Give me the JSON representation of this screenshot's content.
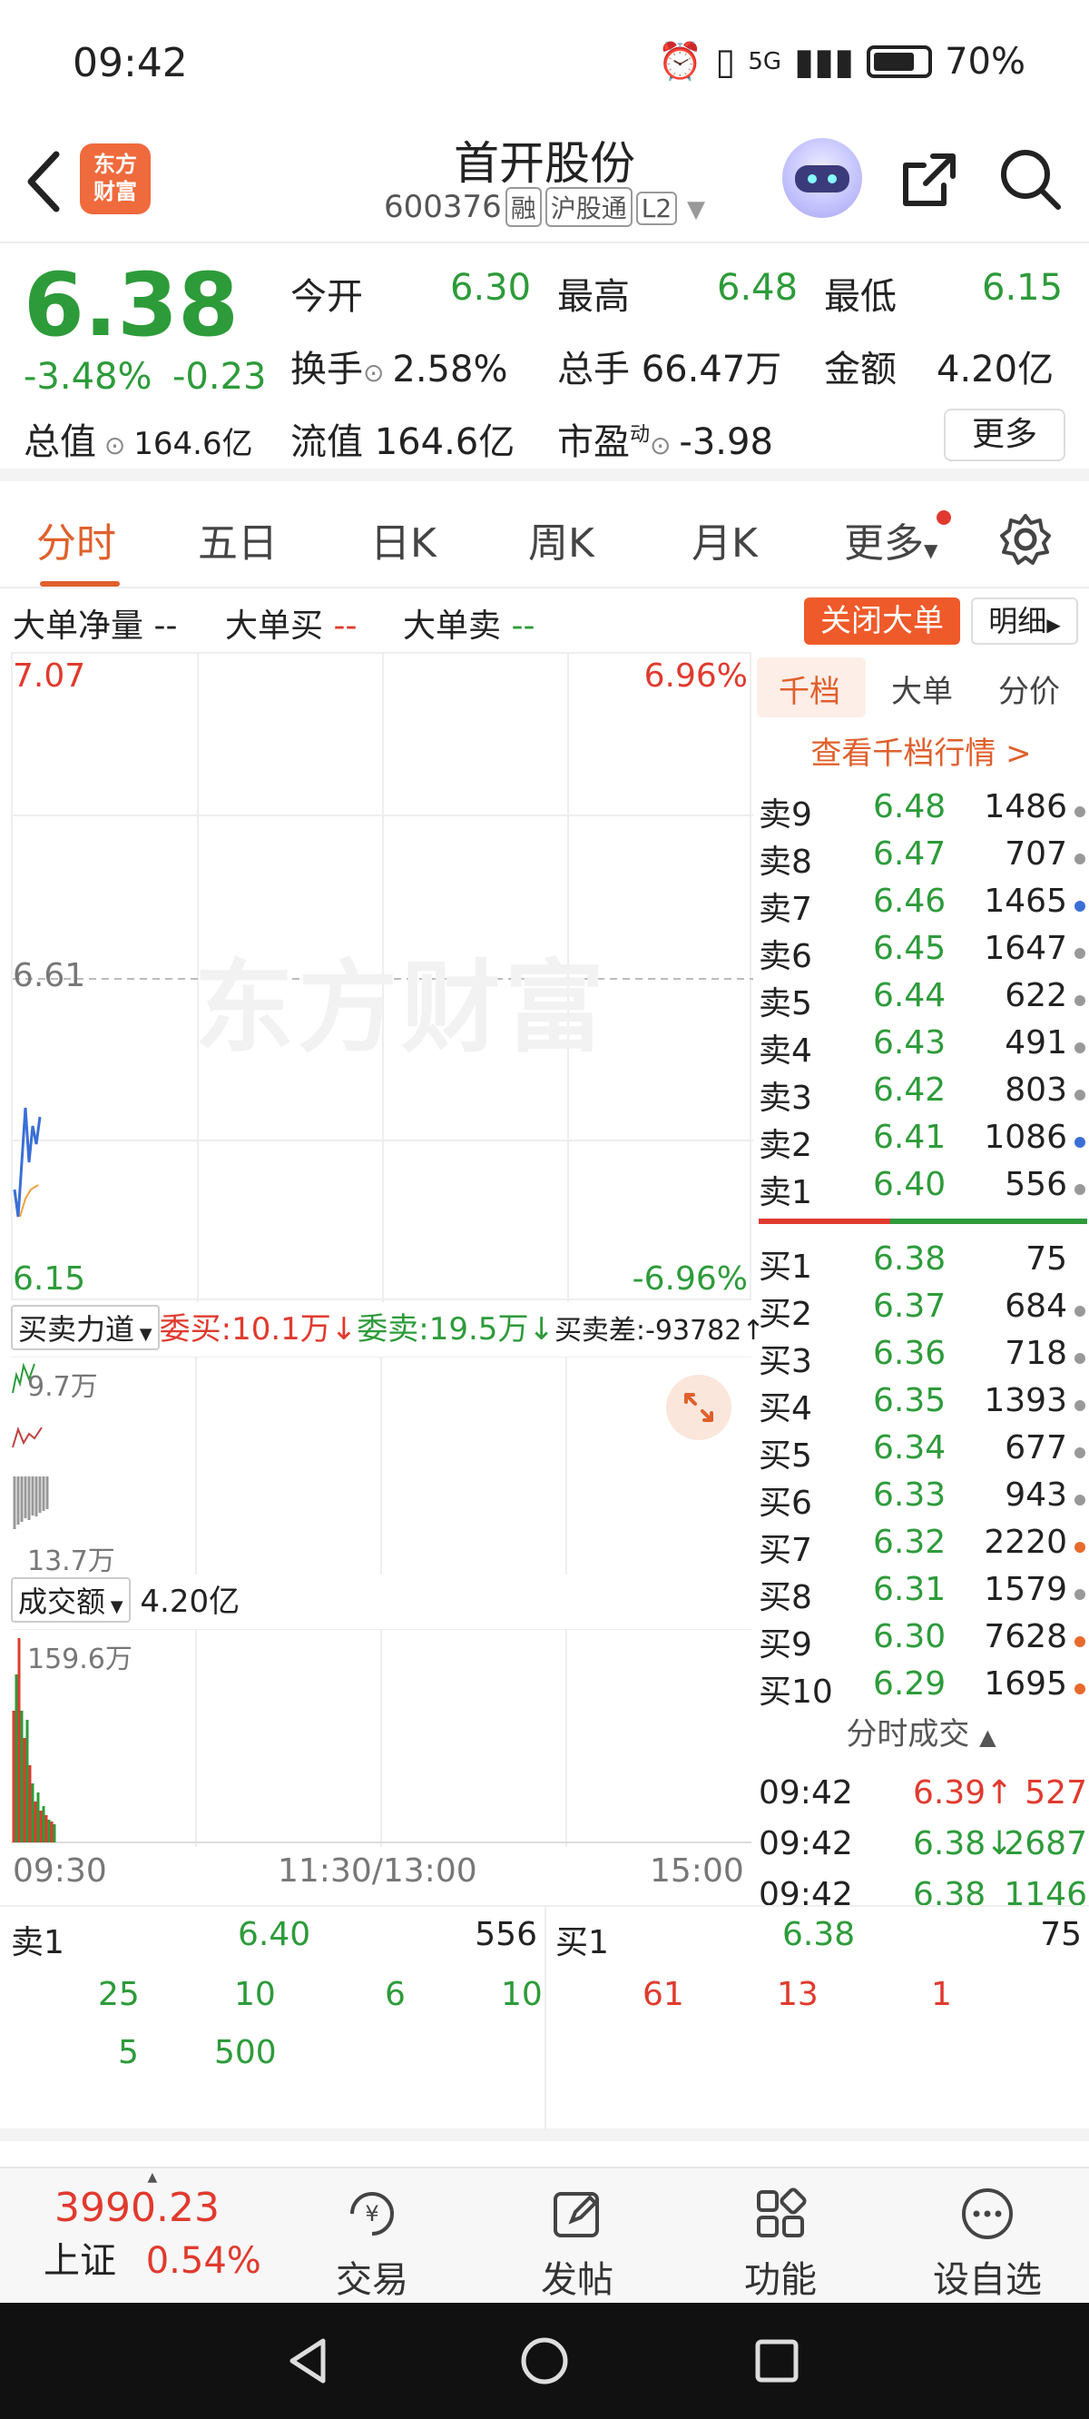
{
  "status_bar": {
    "time": "09:42",
    "network": "5G",
    "battery": "70%"
  },
  "header": {
    "logo_text": "东方\n财富",
    "stock_name": "首开股份",
    "stock_code": "600376",
    "tags": [
      "融",
      "沪股通",
      "L2"
    ]
  },
  "quote": {
    "price": "6.38",
    "change_pct": "-3.48%",
    "change": "-0.23",
    "open_label": "今开",
    "open": "6.30",
    "high_label": "最高",
    "high": "6.48",
    "low_label": "最低",
    "low": "6.15",
    "turnover_label": "换手",
    "turnover": "2.58%",
    "volume_label": "总手",
    "volume": "66.47万",
    "amount_label": "金额",
    "amount": "4.20亿",
    "mktcap_label": "总值",
    "mktcap": "164.6亿",
    "float_label": "流值",
    "float_cap": "164.6亿",
    "pe_label": "市盈",
    "pe_sup": "动",
    "pe": "-3.98",
    "more_label": "更多"
  },
  "tabs": [
    "分时",
    "五日",
    "日K",
    "周K",
    "月K",
    "更多"
  ],
  "big_order": {
    "net_label": "大单净量",
    "net_value": "--",
    "buy_label": "大单买",
    "buy_value": "--",
    "sell_label": "大单卖",
    "sell_value": "--",
    "close_button": "关闭大单",
    "detail_button": "明细"
  },
  "chart": {
    "top_price": "7.07",
    "top_pct": "6.96%",
    "mid_price": "6.61",
    "bottom_price": "6.15",
    "bottom_pct": "-6.96%",
    "watermark": "东方财富",
    "time_start": "09:30",
    "time_mid": "11:30/13:00",
    "time_end": "15:00"
  },
  "force": {
    "dropdown": "买卖力道",
    "bid_label": "委买:",
    "bid_value": "10.1万",
    "ask_label": "委卖:",
    "ask_value": "19.5万",
    "diff_label": "买卖差:",
    "diff_value": "-93782",
    "top_scale": "9.7万",
    "bottom_scale": "13.7万"
  },
  "volume": {
    "dropdown": "成交额",
    "total": "4.20亿",
    "scale": "159.6万"
  },
  "order_book": {
    "tabs": [
      "千档",
      "大单",
      "分价"
    ],
    "link": "查看千档行情 >",
    "asks": [
      {
        "label": "卖9",
        "price": "6.48",
        "vol": "1486",
        "dot": "#999999"
      },
      {
        "label": "卖8",
        "price": "6.47",
        "vol": "707",
        "dot": "#999999"
      },
      {
        "label": "卖7",
        "price": "6.46",
        "vol": "1465",
        "dot": "#3b6fd6"
      },
      {
        "label": "卖6",
        "price": "6.45",
        "vol": "1647",
        "dot": "#999999"
      },
      {
        "label": "卖5",
        "price": "6.44",
        "vol": "622",
        "dot": "#999999"
      },
      {
        "label": "卖4",
        "price": "6.43",
        "vol": "491",
        "dot": "#999999"
      },
      {
        "label": "卖3",
        "price": "6.42",
        "vol": "803",
        "dot": "#999999"
      },
      {
        "label": "卖2",
        "price": "6.41",
        "vol": "1086",
        "dot": "#3b6fd6"
      },
      {
        "label": "卖1",
        "price": "6.40",
        "vol": "556",
        "dot": "#999999"
      }
    ],
    "bids": [
      {
        "label": "买1",
        "price": "6.38",
        "vol": "75",
        "dot": ""
      },
      {
        "label": "买2",
        "price": "6.37",
        "vol": "684",
        "dot": "#999999"
      },
      {
        "label": "买3",
        "price": "6.36",
        "vol": "718",
        "dot": "#999999"
      },
      {
        "label": "买4",
        "price": "6.35",
        "vol": "1393",
        "dot": "#999999"
      },
      {
        "label": "买5",
        "price": "6.34",
        "vol": "677",
        "dot": "#999999"
      },
      {
        "label": "买6",
        "price": "6.33",
        "vol": "943",
        "dot": "#999999"
      },
      {
        "label": "买7",
        "price": "6.32",
        "vol": "2220",
        "dot": "#e86a2c"
      },
      {
        "label": "买8",
        "price": "6.31",
        "vol": "1579",
        "dot": "#999999"
      },
      {
        "label": "买9",
        "price": "6.30",
        "vol": "7628",
        "dot": "#e86a2c"
      },
      {
        "label": "买10",
        "price": "6.29",
        "vol": "1695",
        "dot": "#e86a2c"
      }
    ],
    "trades_label": "分时成交",
    "trades": [
      {
        "time": "09:42",
        "price": "6.39",
        "arrow": "↑",
        "vol": "527",
        "color": "#e03a2e"
      },
      {
        "time": "09:42",
        "price": "6.38",
        "arrow": "↓",
        "vol": "2687",
        "color": "#2d9b3a"
      },
      {
        "time": "09:42",
        "price": "6.38",
        "arrow": "",
        "vol": "1146",
        "color": "#2d9b3a"
      }
    ]
  },
  "level": {
    "sell_label": "卖1",
    "sell_price": "6.40",
    "sell_vol": "556",
    "sell_queue": [
      "25",
      "10",
      "6",
      "10",
      "5",
      "500"
    ],
    "buy_label": "买1",
    "buy_price": "6.38",
    "buy_vol": "75",
    "buy_queue": [
      "61",
      "13",
      "1"
    ]
  },
  "bottom_nav": {
    "index_value": "3990.23",
    "index_name": "上证",
    "index_pct": "0.54%",
    "items": [
      "交易",
      "发帖",
      "功能",
      "设自选"
    ]
  },
  "colors": {
    "up": "#e03a2e",
    "down": "#2d9b3a",
    "accent": "#e0602c",
    "blue_line": "#3b6fd6",
    "avg_line": "#f0a040"
  }
}
